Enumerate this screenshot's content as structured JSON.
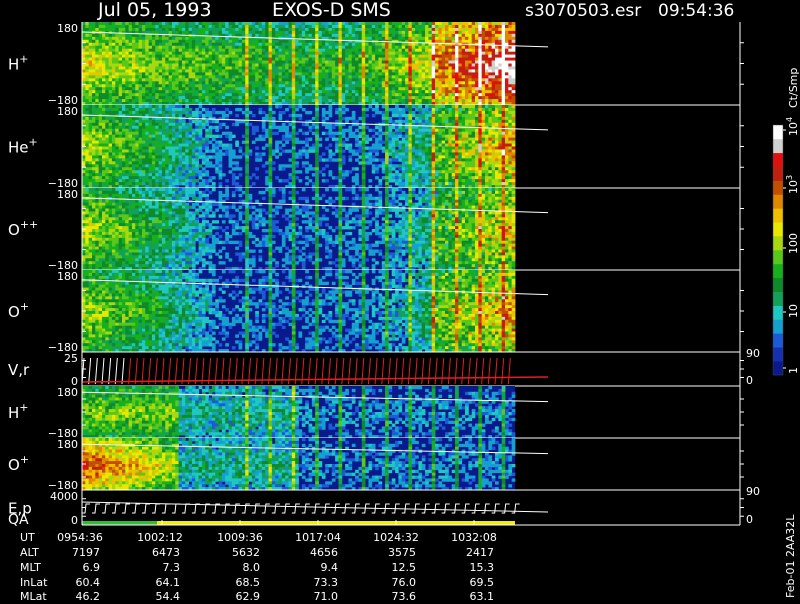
{
  "header": {
    "date": "Jul 05, 1993",
    "instrument": "EXOS-D SMS",
    "file": "s3070503.esr",
    "time": "09:54:36"
  },
  "colors": {
    "background": "#000000",
    "low_flux": "#0a1a8c",
    "axis_line": "#ffffff",
    "trace_red": "#e02020",
    "trace_white": "#ffffff",
    "qa_green": "#2ec02e",
    "qa_yellow": "#f0f000"
  },
  "colorbar": {
    "unit": "Ct/Smp",
    "ticks": [
      "1",
      "10",
      "100",
      "10",
      "10"
    ],
    "superscripts": [
      "",
      "",
      "",
      "3",
      "4"
    ],
    "colors": [
      "#0a1a8c",
      "#1530b0",
      "#1c5ad8",
      "#15a0d0",
      "#1fc8c0",
      "#12a05a",
      "#0e8a2a",
      "#16b01e",
      "#5ac81a",
      "#a8d810",
      "#e8e800",
      "#f0c000",
      "#e08800",
      "#c05000",
      "#c02010",
      "#e01010",
      "#d0d0d0",
      "#ffffff"
    ]
  },
  "panels": [
    {
      "label": "H",
      "sup": "+",
      "ymax": "180",
      "ymin": "−180",
      "kind": "spectrogram"
    },
    {
      "label": "He",
      "sup": "+",
      "ymax": "180",
      "ymin": "−180",
      "kind": "spectrogram"
    },
    {
      "label": "O",
      "sup": "++",
      "ymax": "180",
      "ymin": "−180",
      "kind": "spectrogram"
    },
    {
      "label": "O",
      "sup": "+",
      "ymax": "180",
      "ymin": "−180",
      "kind": "spectrogram"
    },
    {
      "label": "V,r",
      "sup": "",
      "ymax": "25",
      "ymin": "0",
      "right_top": "90",
      "right_bottom": "0",
      "kind": "trace"
    },
    {
      "label": "H",
      "sup": "+",
      "ymax": "180",
      "ymin": "−180",
      "kind": "spectrogram2"
    },
    {
      "label": "O",
      "sup": "+",
      "ymax": "180",
      "ymin": "−180",
      "kind": "spectrogram2"
    },
    {
      "label": "E,p",
      "label2": "QA",
      "sup": "",
      "ymax": "4000",
      "ymin": "0",
      "right_top": "90",
      "right_bottom": "0",
      "kind": "ep"
    }
  ],
  "ephemeris": {
    "row_labels": [
      "UT",
      "ALT",
      "MLT",
      "InLat",
      "MLat"
    ],
    "rows": [
      [
        "0954:36",
        "1002:12",
        "1009:36",
        "1017:04",
        "1024:32",
        "1032:08"
      ],
      [
        "7197",
        "6473",
        "5632",
        "4656",
        "3575",
        "2417"
      ],
      [
        "6.9",
        "7.3",
        "8.0",
        "9.4",
        "12.5",
        "15.3"
      ],
      [
        "60.4",
        "64.1",
        "68.5",
        "73.3",
        "76.0",
        "69.5"
      ],
      [
        "46.2",
        "54.4",
        "62.9",
        "71.0",
        "73.6",
        "63.1"
      ]
    ]
  },
  "footer_code": "Feb-01 2AA32L",
  "chart_data": {
    "type": "heatmap",
    "title": "Jul 05, 1993 EXOS-D SMS",
    "x_tick_labels": [
      "0954:36",
      "1002:12",
      "1009:36",
      "1017:04",
      "1024:32",
      "1032:08"
    ],
    "y_range_pitch": [
      -180,
      180
    ],
    "colorbar_unit": "Ct/Smp",
    "colorbar_range": [
      1,
      10000
    ],
    "series": [
      {
        "name": "H+",
        "relative_flux": [
          0.55,
          0.45,
          0.4,
          0.35,
          0.4,
          0.6,
          0.85
        ]
      },
      {
        "name": "He+",
        "relative_flux": [
          0.5,
          0.35,
          0.1,
          0.1,
          0.12,
          0.35,
          0.55
        ]
      },
      {
        "name": "O++",
        "relative_flux": [
          0.5,
          0.35,
          0.1,
          0.1,
          0.12,
          0.3,
          0.5
        ]
      },
      {
        "name": "O+",
        "relative_flux": [
          0.5,
          0.35,
          0.1,
          0.1,
          0.12,
          0.35,
          0.55
        ]
      }
    ]
  }
}
